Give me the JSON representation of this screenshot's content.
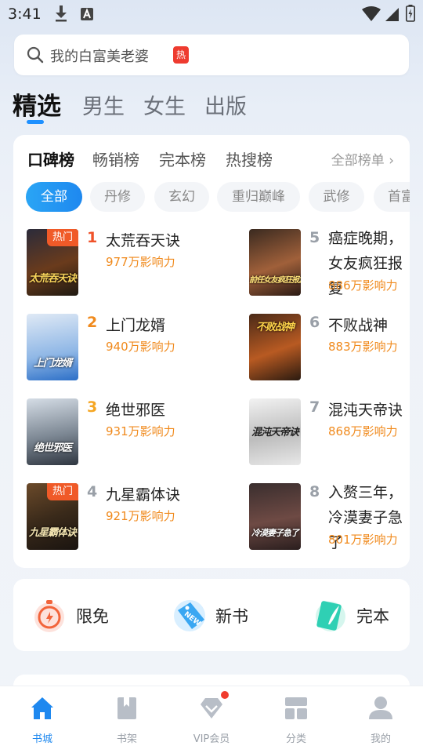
{
  "status_bar": {
    "time": "3:41"
  },
  "search": {
    "placeholder": "我的白富美老婆",
    "hot_badge": "热"
  },
  "top_tabs": [
    "精选",
    "男生",
    "女生",
    "出版"
  ],
  "rank_tabs": [
    "口碑榜",
    "畅销榜",
    "完本榜",
    "热搜榜"
  ],
  "rank_all": "全部榜单 ›",
  "chips": [
    "全部",
    "丹修",
    "玄幻",
    "重归巅峰",
    "武修",
    "首富"
  ],
  "books": [
    {
      "rank": "1",
      "title": "太荒吞天诀",
      "influence": "977万影响力",
      "tag": "热门",
      "cover_text": "太荒吞天诀",
      "rank_color": "#f0522a"
    },
    {
      "rank": "2",
      "title": "上门龙婿",
      "influence": "940万影响力",
      "tag": "",
      "cover_text": "上门龙婿",
      "rank_color": "#f08a1d"
    },
    {
      "rank": "3",
      "title": "绝世邪医",
      "influence": "931万影响力",
      "tag": "",
      "cover_text": "绝世邪医",
      "rank_color": "#f5a623"
    },
    {
      "rank": "4",
      "title": "九星霸体诀",
      "influence": "921万影响力",
      "tag": "热门",
      "cover_text": "九星霸体诀",
      "rank_color": "#9aa0a8"
    },
    {
      "rank": "5",
      "title": "癌症晚期，女友疯狂报复",
      "influence": "886万影响力",
      "tag": "",
      "cover_text": "前任女友疯狂报复我",
      "rank_color": "#9aa0a8"
    },
    {
      "rank": "6",
      "title": "不败战神",
      "influence": "883万影响力",
      "tag": "",
      "cover_text": "不败战神",
      "rank_color": "#9aa0a8"
    },
    {
      "rank": "7",
      "title": "混沌天帝诀",
      "influence": "868万影响力",
      "tag": "",
      "cover_text": "混沌天帝诀",
      "rank_color": "#9aa0a8"
    },
    {
      "rank": "8",
      "title": "入赘三年，冷漠妻子急了",
      "influence": "801万影响力",
      "tag": "",
      "cover_text": "冷漠妻子急了",
      "rank_color": "#9aa0a8"
    }
  ],
  "quick_entries": [
    "限免",
    "新书",
    "完本"
  ],
  "new_badge": "NEW",
  "bottom_nav": [
    "书城",
    "书架",
    "VIP会员",
    "分类",
    "我的"
  ],
  "colors": {
    "accent": "#1e88ef",
    "hot": "#f08a1d",
    "badge_red": "#ee3b2f"
  }
}
